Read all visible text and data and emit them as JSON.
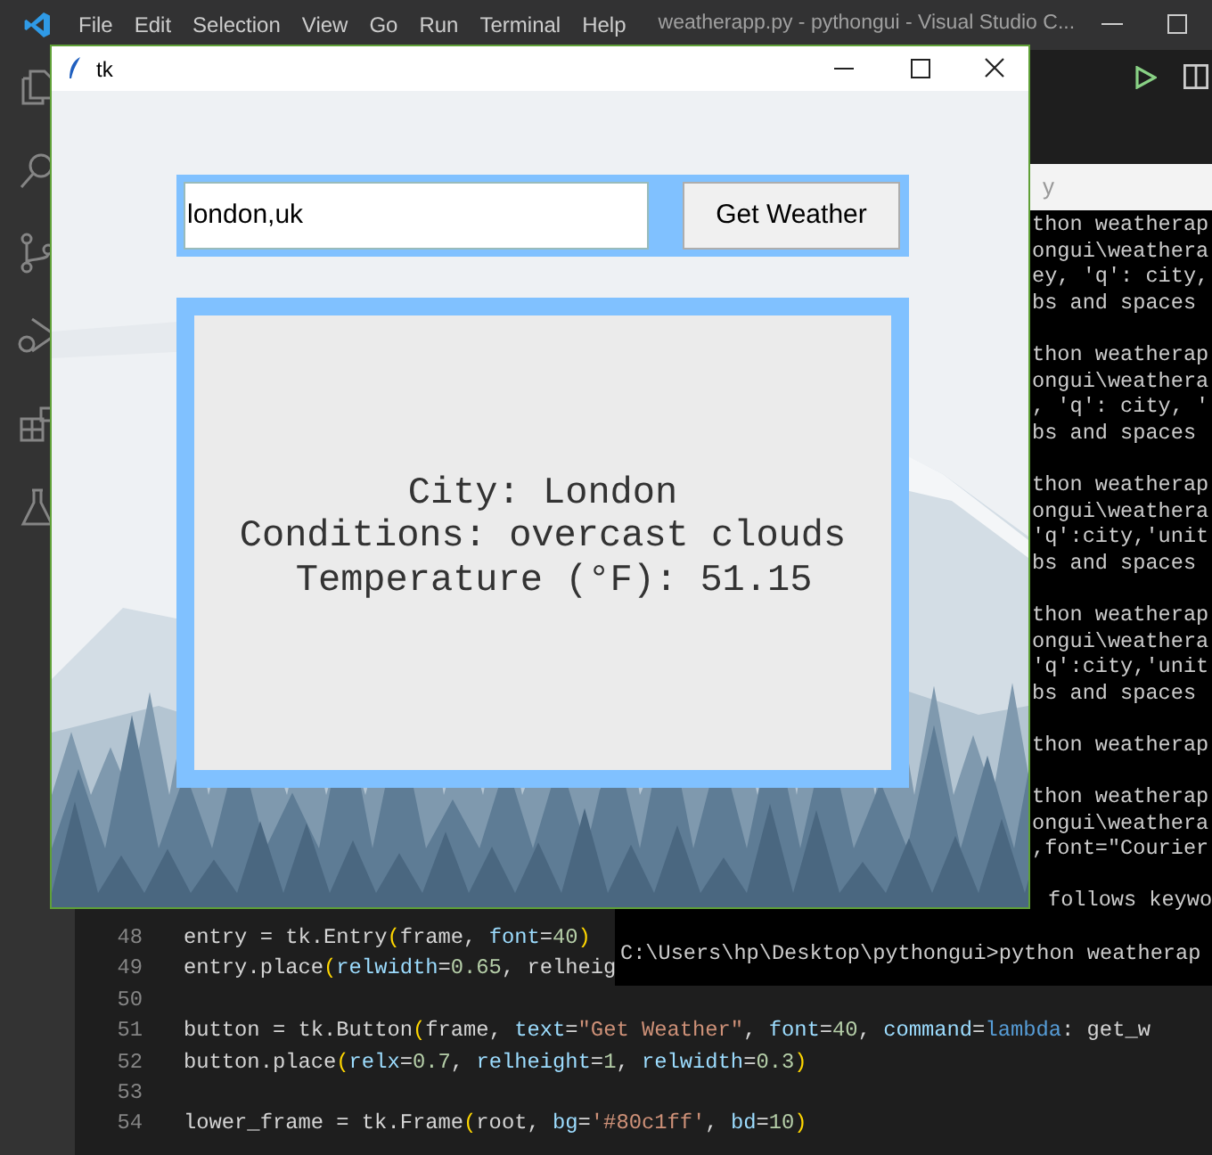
{
  "vscode": {
    "menu": [
      "File",
      "Edit",
      "Selection",
      "View",
      "Go",
      "Run",
      "Terminal",
      "Help"
    ],
    "title": "weatherapp.py - pythongui - Visual Studio C..."
  },
  "editor": {
    "lines": [
      {
        "number": "48",
        "code": "entry = tk.Entry(frame, font=40)"
      },
      {
        "number": "49",
        "code": "entry.place(relwidth=0.65, relheig"
      },
      {
        "number": "50"
      },
      {
        "number": "51",
        "code": "button = tk.Button(frame, text=\"Get Weather\", font=40, command=lambda: get_w"
      },
      {
        "number": "52",
        "code": "button.place(relx=0.7, relheight=1, relwidth=0.3)"
      },
      {
        "number": "53"
      },
      {
        "number": "54",
        "code": "lower_frame = tk.Frame(root, bg='#80c1ff', bd=10)"
      }
    ]
  },
  "terminal": {
    "title": "y",
    "blocks": [
      [
        "thon weatherap",
        "ongui\\weathera",
        "ey, 'q': city,",
        "bs and spaces"
      ],
      [
        "thon weatherap",
        "ongui\\weathera",
        ", 'q': city, '",
        "bs and spaces"
      ],
      [
        "thon weatherap",
        "ongui\\weathera",
        "'q':city,'unit",
        "bs and spaces"
      ],
      [
        "thon weatherap",
        "ongui\\weathera",
        "'q':city,'unit",
        "bs and spaces"
      ],
      [
        "thon weatherap"
      ],
      [
        "thon weatherap",
        "ongui\\weathera",
        ",font=\"Courier"
      ],
      [
        "follows keywo"
      ]
    ],
    "prompt": "C:\\Users\\hp\\Desktop\\pythongui>python weatherap"
  },
  "tk_window": {
    "title": "tk",
    "entry": {
      "value": "london,uk"
    },
    "button": "Get Weather",
    "result": [
      "City: London",
      "Conditions: overcast clouds",
      " Temperature (°F): 51.15"
    ]
  }
}
